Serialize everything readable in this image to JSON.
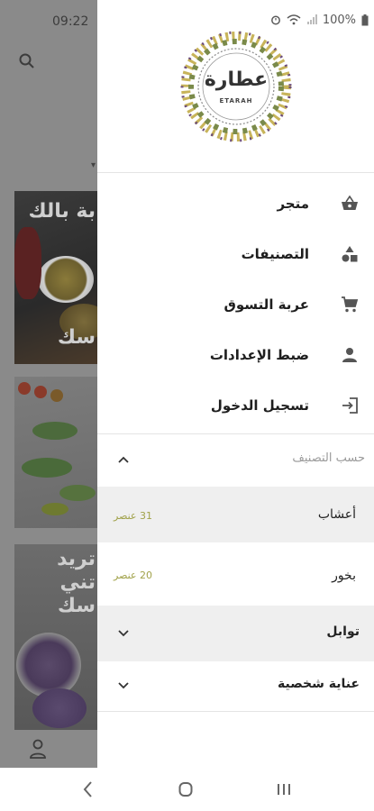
{
  "background": {
    "time": "09:22",
    "tile1_text_top": "بة بالك",
    "tile1_text_bottom": "سك",
    "tile3_text_1": "تريد",
    "tile3_text_2": "تني",
    "tile3_text_3": "سك"
  },
  "status_bar": {
    "battery": "100%"
  },
  "brand": {
    "logo_text": "عطارة",
    "logo_sub": "ETARAH"
  },
  "menu": [
    {
      "label": "متجر",
      "icon": "shopping-basket-icon"
    },
    {
      "label": "التصنيفات",
      "icon": "categories-shapes-icon"
    },
    {
      "label": "عربة التسوق",
      "icon": "shopping-cart-icon"
    },
    {
      "label": "ضبط الإعدادات",
      "icon": "person-icon"
    },
    {
      "label": "تسجيل الدخول",
      "icon": "login-icon"
    }
  ],
  "categories": {
    "header": "حسب التصنيف",
    "items": [
      {
        "label": "أعشاب",
        "count": "31 عنصر"
      },
      {
        "label": "بخور",
        "count": "20 عنصر"
      },
      {
        "label": "توابل",
        "count": ""
      },
      {
        "label": "عناية شخصية",
        "count": ""
      }
    ]
  },
  "colors": {
    "accent_count": "#a1a24a",
    "scrim": "#8a8a8a"
  }
}
